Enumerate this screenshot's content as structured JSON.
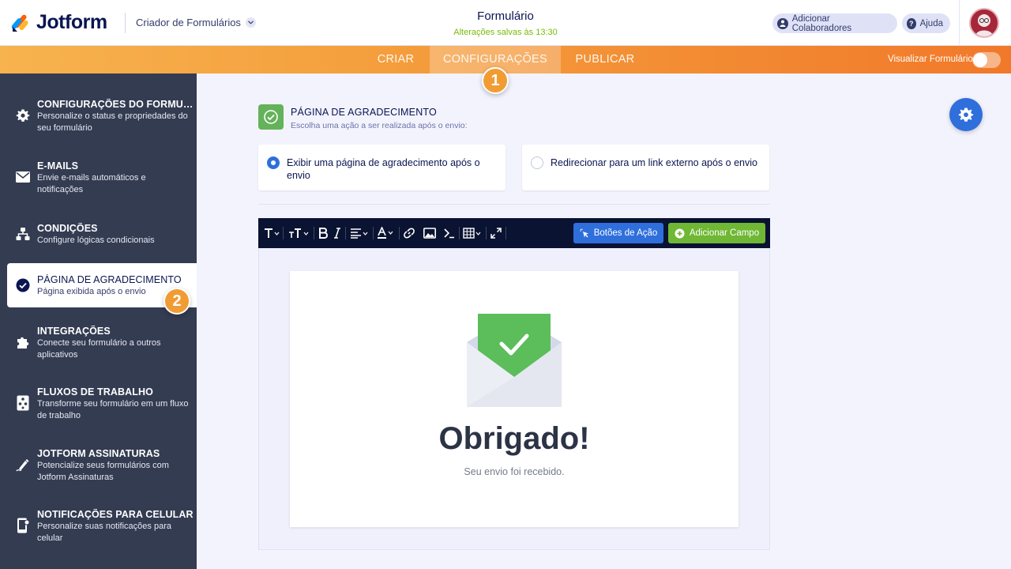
{
  "header": {
    "logo_text": "Jotform",
    "builder_label": "Criador de Formulários",
    "form_title": "Formulário",
    "saved_status": "Alterações salvas às 13:30",
    "collaborators_label": "Adicionar Colaboradores",
    "help_label": "Ajuda"
  },
  "nav": {
    "tabs": [
      {
        "label": "CRIAR"
      },
      {
        "label": "CONFIGURAÇÕES"
      },
      {
        "label": "PUBLICAR"
      }
    ],
    "active_tab": "CONFIGURAÇÕES",
    "preview_label": "Visualizar Formulário",
    "preview_on": false
  },
  "badges": [
    "1",
    "2"
  ],
  "sidebar": {
    "items": [
      {
        "title": "CONFIGURAÇÕES DO FORMULÁRIO",
        "desc": "Personalize o status e propriedades do seu formulário",
        "icon": "gear-icon"
      },
      {
        "title": "E-MAILS",
        "desc": "Envie e-mails automáticos e notificações",
        "icon": "envelope-icon"
      },
      {
        "title": "CONDIÇÕES",
        "desc": "Configure lógicas condicionais",
        "icon": "sitemap-icon"
      },
      {
        "title": "PÁGINA DE AGRADECIMENTO",
        "desc": "Página exibida após o envio",
        "icon": "check-circle-icon"
      },
      {
        "title": "INTEGRAÇÕES",
        "desc": "Conecte seu formulário a outros aplicativos",
        "icon": "puzzle-icon"
      },
      {
        "title": "FLUXOS DE TRABALHO",
        "desc": "Transforme seu formulário em um fluxo de trabalho",
        "icon": "workflow-icon"
      },
      {
        "title": "JOTFORM ASSINATURAS",
        "desc": "Potencialize seus formulários com Jotform Assinaturas",
        "icon": "signature-icon"
      },
      {
        "title": "NOTIFICAÇÕES PARA CELULAR",
        "desc": "Personalize suas notificações para celular",
        "icon": "mobile-icon"
      }
    ],
    "active_index": 3
  },
  "main": {
    "section_title": "PÁGINA DE AGRADECIMENTO",
    "section_subtitle": "Escolha uma ação a ser realizada após o envio:",
    "options": [
      {
        "label": "Exibir uma página de agradecimento após o envio",
        "selected": true
      },
      {
        "label": "Redirecionar para um link externo após o envio",
        "selected": false
      }
    ],
    "toolbar": {
      "action_buttons_label": "Botões de Ação",
      "add_field_label": "Adicionar Campo"
    },
    "thanks": {
      "title": "Obrigado!",
      "subtitle": "Seu envio foi recebido."
    }
  },
  "colors": {
    "accent_blue": "#2f6fdc",
    "accent_green": "#64b25a",
    "nav_orange": "#f49a3a",
    "sidebar_bg": "#343c52"
  }
}
